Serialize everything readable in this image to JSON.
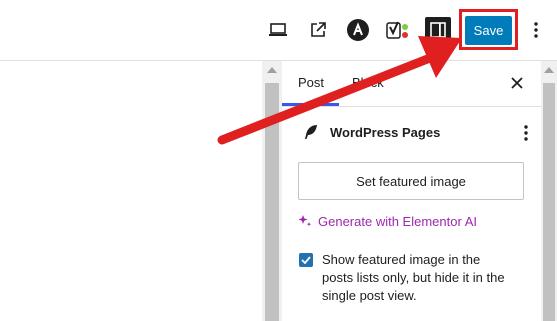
{
  "toolbar": {
    "icons": [
      "laptop-icon",
      "external-link-icon",
      "astra-icon",
      "yoast-icon",
      "sidebar-toggle-icon",
      "more-options-icon"
    ],
    "save_label": "Save"
  },
  "sidebar": {
    "tabs": [
      {
        "label": "Post",
        "active": true
      },
      {
        "label": "Block",
        "active": false
      }
    ],
    "panel_title": "WordPress Pages",
    "set_featured_label": "Set featured image",
    "ai_link_label": "Generate with Elementor AI",
    "checkbox_checked": true,
    "checkbox_label": "Show featured image in the posts lists only, but hide it in the single post view."
  },
  "colors": {
    "accent": "#007cba",
    "highlight": "#e02020",
    "ai": "#9d2aab",
    "checkbox": "#2271b1"
  }
}
